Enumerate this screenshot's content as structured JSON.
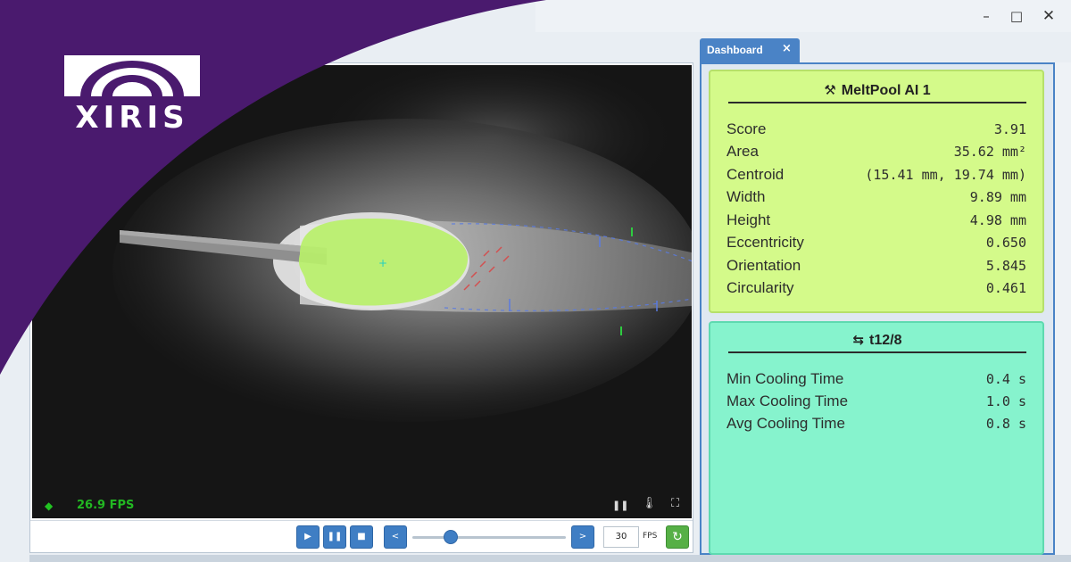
{
  "window": {
    "minimize_glyph": "–",
    "maximize_glyph": "□",
    "close_glyph": "✕"
  },
  "brand": {
    "name": "XIRIS",
    "color": "#4a1a6e"
  },
  "viewer": {
    "fps_indicator": "◆",
    "fps_label": "26.9 FPS",
    "overlay_icons": [
      "pause-icon",
      "thermometer-icon",
      "fullscreen-icon"
    ],
    "overlay_glyphs": {
      "pause": "❚❚",
      "temp": "🌡",
      "fullscreen": "⛶"
    },
    "controls": {
      "play": "▶",
      "pause": "❚❚",
      "stop": "■",
      "prev": "<",
      "next": ">",
      "fps_value": "30",
      "fps_unit": "FPS",
      "refresh": "↻",
      "slider_fraction": 0.25
    }
  },
  "dashboard": {
    "tab_label": "Dashboard",
    "tab_close": "×",
    "meltpool": {
      "icon": "⚒",
      "title": "MeltPool AI 1",
      "color": "#d4fa8a",
      "rows": [
        {
          "label": "Score",
          "value": "3.91"
        },
        {
          "label": "Area",
          "value": "35.62 mm²"
        },
        {
          "label": "Centroid",
          "value": "(15.41 mm, 19.74 mm)"
        },
        {
          "label": "Width",
          "value": "9.89 mm"
        },
        {
          "label": "Height",
          "value": "4.98 mm"
        },
        {
          "label": "Eccentricity",
          "value": "0.650"
        },
        {
          "label": "Orientation",
          "value": "5.845"
        },
        {
          "label": "Circularity",
          "value": "0.461"
        }
      ]
    },
    "cooling": {
      "icon": "⇆",
      "title": "t12/8",
      "color": "#86f3cd",
      "rows": [
        {
          "label": "Min Cooling Time",
          "value": "0.4 s"
        },
        {
          "label": "Max Cooling Time",
          "value": "1.0 s"
        },
        {
          "label": "Avg Cooling Time",
          "value": "0.8 s"
        }
      ]
    }
  }
}
